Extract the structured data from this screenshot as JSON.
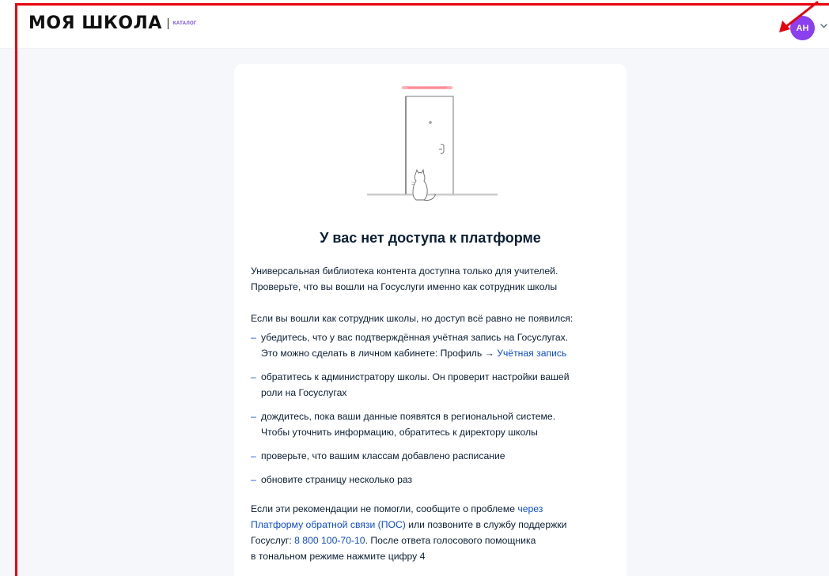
{
  "header": {
    "logo_text": "МОЯ ШКОЛА",
    "logo_subtitle": "КАТАЛОГ",
    "avatar_initials": "АН"
  },
  "card": {
    "title": "У вас нет доступа к платформе",
    "intro_line1": "Универсальная библиотека контента доступна только для учителей.",
    "intro_line2": "Проверьте, что вы вошли на Госуслуги именно как сотрудник школы",
    "if_logged_in": "Если вы вошли как сотрудник школы, но доступ всё равно не появился:",
    "recommendations": [
      {
        "line1": "убедитесь, что у вас подтверждённая учётная запись на Госуслугах.",
        "line2_prefix": "Это можно сделать в личном кабинете: Профиль → ",
        "line2_link": "Учётная запись"
      },
      {
        "line1": "обратитесь к администратору школы. Он проверит настройки вашей",
        "line2": "роли на Госуслугах"
      },
      {
        "line1": "дождитесь, пока ваши данные появятся в региональной системе.",
        "line2": "Чтобы уточнить информацию, обратитесь к директору школы"
      },
      {
        "line1": "проверьте, что вашим классам добавлено расписание"
      },
      {
        "line1": "обновите страницу несколько раз"
      }
    ],
    "dash": "–",
    "footer": {
      "part1": "Если эти рекомендации не помогли, сообщите о проблеме ",
      "link1_a": "через",
      "link1_b": "Платформу обратной связи (ПОС)",
      "part2": " или позвоните в службу поддержки",
      "part3": "Госуслуг: ",
      "phone": "8 800 100-70-10",
      "part4": ". После ответа голосового помощника",
      "part5": "в тональном режиме нажмите цифру 4"
    }
  },
  "colors": {
    "accent_link": "#0d4cd3",
    "avatar_bg": "#8a3ff0",
    "annotation_red": "#e8000b",
    "door_light": "#ff6b7a"
  }
}
